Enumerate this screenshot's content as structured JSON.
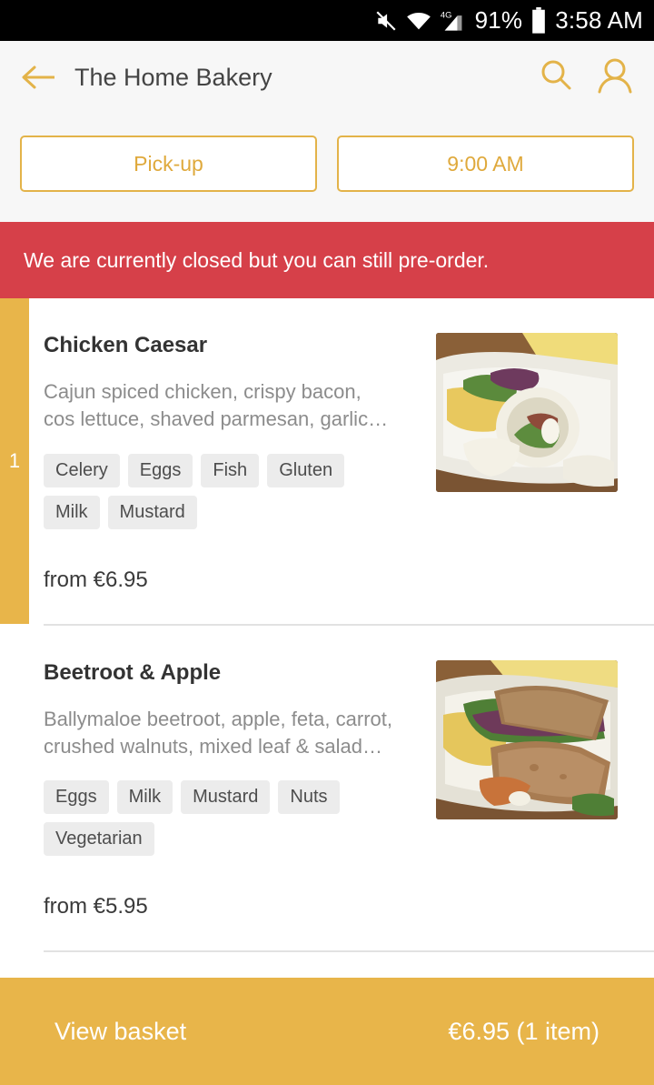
{
  "statusbar": {
    "mute_icon": "mute-icon",
    "wifi_icon": "wifi-icon",
    "network_label": "4G",
    "signal_icon": "signal-icon",
    "battery_percent": "91%",
    "battery_icon": "battery-icon",
    "clock": "3:58 AM"
  },
  "header": {
    "back_icon": "back-arrow-icon",
    "title": "The Home Bakery",
    "search_icon": "search-icon",
    "account_icon": "person-icon"
  },
  "options": {
    "fulfilment": "Pick-up",
    "time": "9:00 AM"
  },
  "banner": {
    "message": "We are currently closed but you can still pre-order."
  },
  "menu": {
    "items": [
      {
        "quantity": "1",
        "name": "Chicken Caesar",
        "description": "Cajun spiced chicken, crispy bacon, cos lettuce, shaved parmesan, garlic…",
        "tags": [
          "Celery",
          "Eggs",
          "Fish",
          "Gluten",
          "Milk",
          "Mustard"
        ],
        "price": "from €6.95",
        "image": "chicken-caesar-wrap-photo"
      },
      {
        "quantity": "",
        "name": "Beetroot & Apple",
        "description": "Ballymaloe beetroot, apple, feta, carrot, crushed walnuts, mixed leaf & salad…",
        "tags": [
          "Eggs",
          "Milk",
          "Mustard",
          "Nuts",
          "Vegetarian"
        ],
        "price": "from €5.95",
        "image": "beetroot-apple-sandwich-photo"
      }
    ]
  },
  "basket": {
    "label": "View basket",
    "total": "€6.95 (1 item)"
  },
  "colors": {
    "accent": "#e8b54a",
    "accent_outline": "#e3b349",
    "alert": "#d64049",
    "header_bg": "#f7f7f7",
    "tag_bg": "#ececec"
  }
}
